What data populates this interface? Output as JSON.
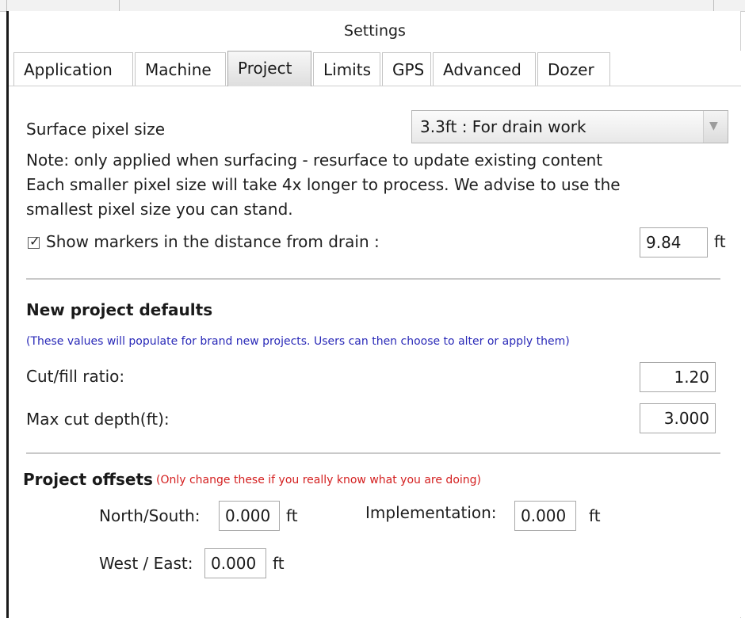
{
  "window": {
    "title": "Settings"
  },
  "tabs": [
    {
      "label": "Application",
      "active": false
    },
    {
      "label": "Machine",
      "active": false
    },
    {
      "label": "Project",
      "active": true
    },
    {
      "label": "Limits",
      "active": false
    },
    {
      "label": "GPS",
      "active": false
    },
    {
      "label": "Advanced",
      "active": false
    },
    {
      "label": "Dozer",
      "active": false
    }
  ],
  "surface": {
    "label": "Surface pixel size",
    "selected": "3.3ft : For drain work",
    "note_lines": [
      "Note: only applied when surfacing - resurface to update existing content",
      "Each smaller pixel size will take 4x longer to process. We advise to use the",
      "smallest pixel size you can stand."
    ]
  },
  "markers": {
    "checkbox_checked": true,
    "check_glyph": "✓",
    "label": "Show markers in the distance from drain :",
    "value": "9.84",
    "unit": "ft"
  },
  "defaults": {
    "heading": "New project defaults",
    "hint": "(These values will populate for brand new projects. Users can then choose to alter or apply them)",
    "cut_fill_label": "Cut/fill ratio:",
    "cut_fill_value": "1.20",
    "max_cut_label": "Max cut depth(ft):",
    "max_cut_value": "3.000"
  },
  "offsets": {
    "heading": "Project offsets",
    "warning": "(Only change these if you really know what you are doing)",
    "north_south_label": "North/South:",
    "north_south_value": "0.000",
    "north_south_unit": "ft",
    "implementation_label": "Implementation:",
    "implementation_value": "0.000",
    "implementation_unit": "ft",
    "west_east_label": "West / East:",
    "west_east_value": "0.000",
    "west_east_unit": "ft"
  },
  "icons": {
    "dropdown": "chevron-down-icon",
    "check": "checkmark-icon"
  },
  "colors": {
    "hint_blue": "#2a2ab8",
    "warning_red": "#d42020",
    "active_tab": "#dedede"
  }
}
